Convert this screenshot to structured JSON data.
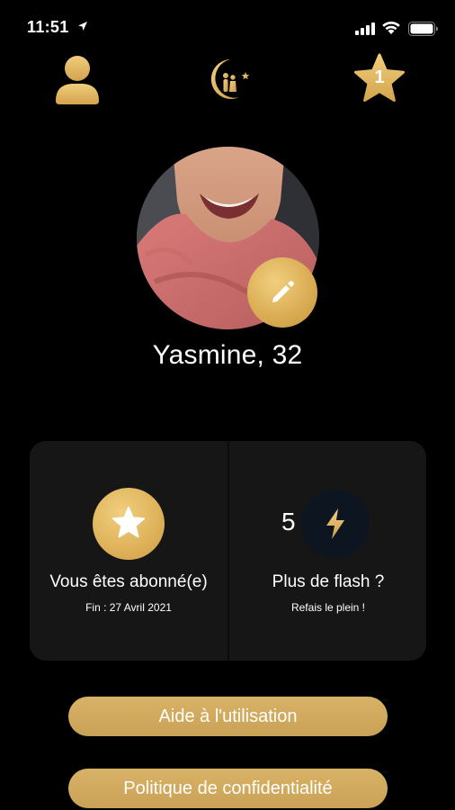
{
  "status_bar": {
    "time": "11:51"
  },
  "nav": {
    "star_count": "1"
  },
  "profile": {
    "name": "Yasmine, 32"
  },
  "cards": {
    "subscription": {
      "title": "Vous êtes abonné(e)",
      "subtitle": "Fin : 27 Avril 2021"
    },
    "flash": {
      "count": "5",
      "title": "Plus de flash ?",
      "subtitle": "Refais le plein !"
    }
  },
  "buttons": {
    "help": "Aide à l'utilisation",
    "privacy": "Politique de confidentialité"
  },
  "icons": {
    "profile": "user-icon",
    "logo": "crescent-couple-logo",
    "favorites": "star-icon",
    "edit": "pencil-icon",
    "subscription": "star-icon",
    "flash": "lightning-icon"
  },
  "colors": {
    "gold": "#d9ab52",
    "background": "#000000",
    "card": "#161616"
  }
}
